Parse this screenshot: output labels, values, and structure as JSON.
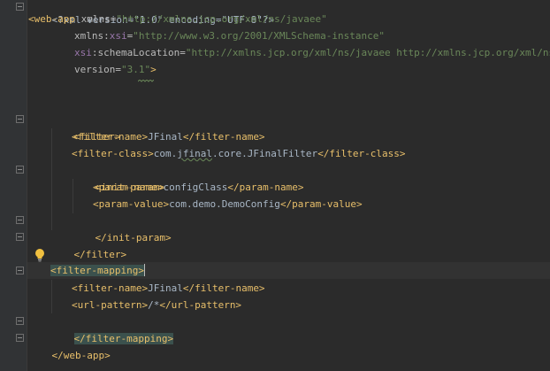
{
  "editor": {
    "theme_colors": {
      "background": "#2b2b2b",
      "gutter": "#313335",
      "tag": "#e8bf6a",
      "attribute": "#bababa",
      "namespace": "#9876aa",
      "value": "#6a8759",
      "text": "#a9b7c6",
      "match_highlight": "#3b514d"
    },
    "lines": {
      "l1": {
        "decl_open": "<?xml version=\"1.0\" encoding=\"UTF-8\"?>"
      },
      "l2": {
        "open": "<web-app",
        "attr": " xmlns",
        "eq": "=",
        "value": "\"http://xmlns.jcp.org/xml/ns/javaee\""
      },
      "l3": {
        "attr": "xmlns",
        "colon": ":",
        "ns": "xsi",
        "eq": "=",
        "value": "\"http://www.w3.org/2001/XMLSchema-instance\""
      },
      "l4": {
        "ns": "xsi",
        "colon": ":",
        "attr": "schemaLocation",
        "eq": "=",
        "value": "\"http://xmlns.jcp.org/xml/ns/javaee http://xmlns.jcp.org/xml/ns/javaee/"
      },
      "l5": {
        "attr": "version",
        "eq": "=",
        "value": "\"3.1\"",
        "close": ">"
      },
      "l8": {
        "tag": "<filter>"
      },
      "l9": {
        "open": "<filter-name>",
        "text": "JFinal",
        "close": "</filter-name>"
      },
      "l10": {
        "open": "<filter-class>",
        "text1": "com.",
        "text_spell": "jfinal",
        "text2": ".core.JFinalFilter",
        "close": "</filter-class>"
      },
      "l11": {
        "tag": "<init-param>"
      },
      "l12": {
        "open": "<param-name>",
        "text": "configClass",
        "close": "</param-name>"
      },
      "l13": {
        "open": "<param-value>",
        "text": "com.demo.DemoConfig",
        "close": "</param-value>"
      },
      "l14": {
        "tag": "</init-param>"
      },
      "l15": {
        "tag": "</filter>"
      },
      "l17": {
        "tag": "<filter-mapping>"
      },
      "l18": {
        "open": "<filter-name>",
        "text": "JFinal",
        "close": "</filter-name>"
      },
      "l19": {
        "open": "<url-pattern>",
        "text": "/*",
        "close": "</url-pattern>"
      },
      "l20": {
        "tag": "</filter-mapping>"
      },
      "l21": {
        "tag": "</web-app>"
      }
    },
    "icons": {
      "intention": "lightbulb-icon",
      "fold": "fold-marker-icon"
    }
  }
}
